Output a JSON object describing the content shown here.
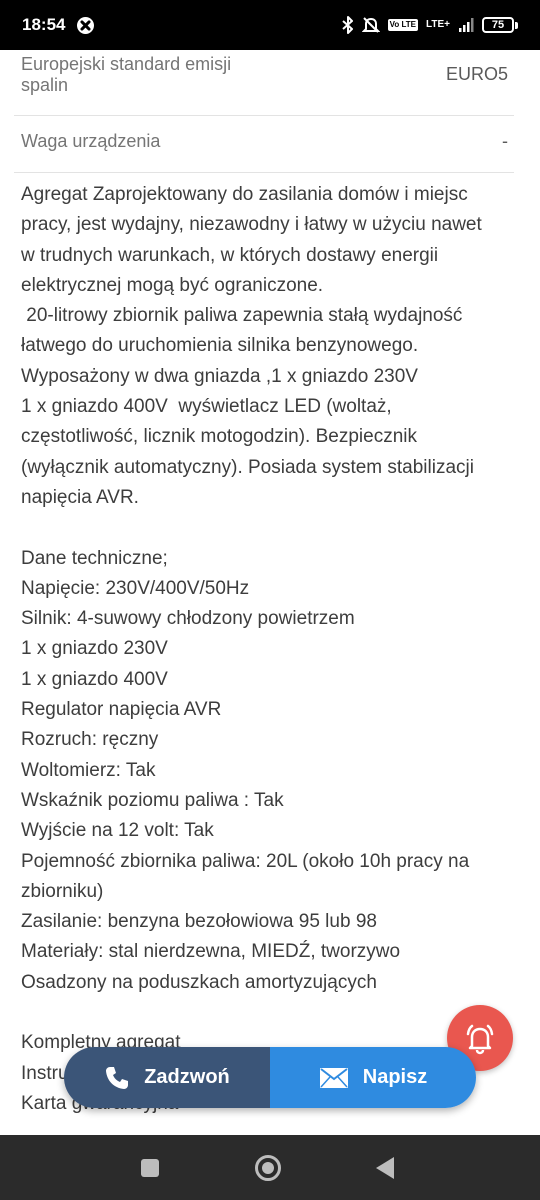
{
  "status_bar": {
    "time": "18:54",
    "battery": "75",
    "volte": "Vo LTE",
    "network": "LTE+",
    "icons": [
      "xbox-icon",
      "bluetooth-icon",
      "mute-icon",
      "signal-icon",
      "battery-icon"
    ]
  },
  "specs": [
    {
      "label": "Europejski standard emisji spalin",
      "value": "EURO5"
    },
    {
      "label": "Waga urządzenia",
      "value": "-"
    }
  ],
  "description_lines": [
    "Agregat Zaprojektowany do zasilania domów i miejsc",
    "pracy, jest wydajny, niezawodny i łatwy w użyciu nawet",
    "w trudnych warunkach, w których dostawy energii",
    "elektrycznej mogą być ograniczone.",
    " 20-litrowy zbiornik paliwa zapewnia stałą wydajność",
    "łatwego do uruchomienia silnika benzynowego.",
    "Wyposażony w dwa gniazda ,1 x gniazdo 230V",
    "1 x gniazdo 400V  wyświetlacz LED (woltaż,",
    "częstotliwość, licznik motogodzin). Bezpiecznik",
    "(wyłącznik automatyczny). Posiada system stabilizacji",
    "napięcia AVR.",
    "",
    "Dane techniczne;",
    "Napięcie: 230V/400V/50Hz",
    "Silnik: 4-suwowy chłodzony powietrzem",
    "1 x gniazdo 230V",
    "1 x gniazdo 400V",
    "Regulator napięcia AVR",
    "Rozruch: ręczny",
    "Woltomierz: Tak",
    "Wskaźnik poziomu paliwa : Tak",
    "Wyjście na 12 volt: Tak",
    "Pojemność zbiornika paliwa: 20L (około 10h pracy na",
    "zbiorniku)",
    "Zasilanie: benzyna bezołowiowa 95 lub 98",
    "Materiały: stal nierdzewna, MIEDŹ, tworzywo",
    "Osadzony na poduszkach amortyzujących",
    "",
    "Kompletny agregat",
    "Instrukcja",
    "Karta gwarancyjna"
  ],
  "actions": {
    "call_label": "Zadzwoń",
    "write_label": "Napisz"
  },
  "colors": {
    "call_bg": "#3b5578",
    "write_bg": "#2f8be0",
    "bell_bg": "#e9574f"
  }
}
